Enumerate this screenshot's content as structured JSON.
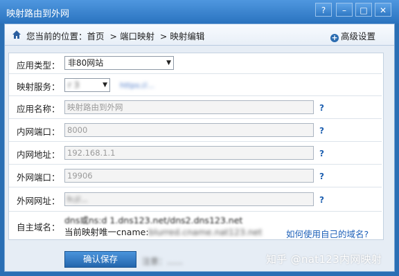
{
  "window": {
    "title": "映射路由到外网",
    "btn_help": "?",
    "btn_min": "–",
    "btn_max": "□",
    "btn_close": "✕"
  },
  "breadcrumb": {
    "prefix": "您当前的位置：",
    "items": [
      "首页",
      "端口映射",
      "映射编辑"
    ],
    "sep": ">",
    "advanced_label": "高级设置"
  },
  "form": {
    "app_type_label": "应用类型：",
    "app_type_value": "非80网站",
    "service_label": "映射服务：",
    "service_value": "r      3",
    "service_extra": "https://...",
    "app_name_label": "应用名称：",
    "app_name_value": "映射路由到外网",
    "lan_port_label": "内网端口：",
    "lan_port_value": "8000",
    "lan_ip_label": "内网地址：",
    "lan_ip_value": "192.168.1.1",
    "wan_port_label": "外网端口：",
    "wan_port_value": "19906",
    "wan_url_label": "外网网址：",
    "wan_url_value": "h://...",
    "domain_label": "自主域名：",
    "domain_line1": "dns或ns:d   1.dns123.net/dns2.dns123.net",
    "domain_line2": "当前映射唯一cname:",
    "domain_line2_blur": "blurred.cname.nat123.net",
    "domain_help_link": "如何使用自己的域名?",
    "help_mark": "?"
  },
  "save_button": "确认保存",
  "footer_blur": "注意：......",
  "watermark": "知乎 @nat123内网映射"
}
